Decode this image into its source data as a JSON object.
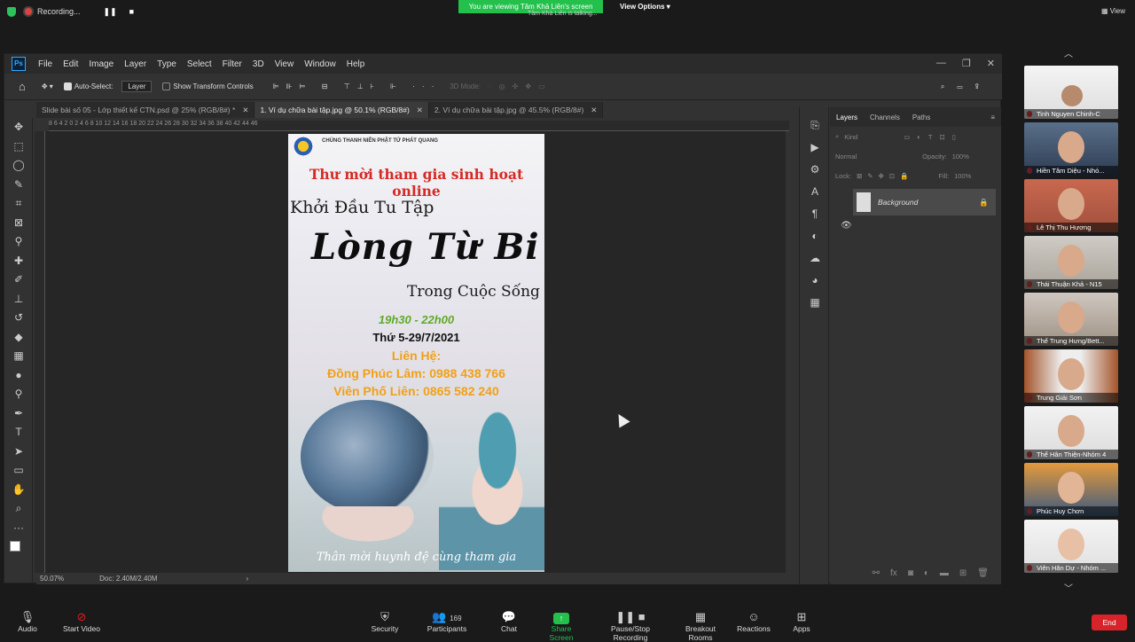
{
  "zoom": {
    "recording_label": "Recording...",
    "viewing_banner": "You are viewing Tâm Khả Liên's screen",
    "view_options": "View Options",
    "talking": "Tâm Khả Liên is talking...",
    "view_label": "View",
    "participants_count": "169",
    "bottom": {
      "audio": "Audio",
      "start_video": "Start Video",
      "security": "Security",
      "participants": "Participants",
      "chat": "Chat",
      "share_screen": "Share Screen",
      "pause_recording": "Pause/Stop Recording",
      "breakout": "Breakout Rooms",
      "reactions": "Reactions",
      "apps": "Apps",
      "end": "End"
    },
    "participants": [
      "Tinh Nguyen Chinh-C",
      "Hiền Tâm Diệu - Nhó...",
      "Lê Thị Thu Hương",
      "Thái Thuận Khả - N15",
      "Thế Trung Hưng/Bett...",
      "Trung Giải Sơn",
      "Thể Hân Thiện-Nhóm 4",
      "Phúc Huy Chơn",
      "Viên Hân Dự - Nhóm ..."
    ]
  },
  "ps": {
    "logo": "Ps",
    "menu": [
      "File",
      "Edit",
      "Image",
      "Layer",
      "Type",
      "Select",
      "Filter",
      "3D",
      "View",
      "Window",
      "Help"
    ],
    "auto_select_label": "Auto-Select:",
    "auto_select_value": "Layer",
    "transform_label": "Show Transform Controls",
    "mode_3d": "3D Mode:",
    "tabs": [
      "Slide bài số 05 - Lớp thiết kế CTN.psd @ 25% (RGB/8#) *",
      "1. Ví dụ chữa bài tập.jpg @ 50.1% (RGB/8#)",
      "2. Ví dụ chữa bài tập.jpg @ 45.5% (RGB/8#)"
    ],
    "zoom_level": "50.07%",
    "doc_size": "Doc: 2.40M/2.40M",
    "panel_tabs": [
      "Layers",
      "Channels",
      "Paths"
    ],
    "kind_label": "Kind",
    "blend_mode": "Normal",
    "opacity_label": "Opacity:",
    "opacity_value": "100%",
    "lock_label": "Lock:",
    "fill_label": "Fill:",
    "fill_value": "100%",
    "layer_name": "Background",
    "ruler_marks": "8   6   4   2   0   2   4   6   8   10   12   14   16   18   20   22   24   26   28   30   32   34   36   38   40   42   44   46"
  },
  "poster": {
    "org": "CHÚNG THANH NIÊN PHẬT TỬ PHÁT QUANG",
    "title": "Thư mời tham gia sinh hoạt online",
    "line1": "Khởi Đầu Tu Tập",
    "line2": "Lòng Từ Bi",
    "line3": "Trong  Cuộc Sống",
    "time": "19h30 - 22h00",
    "date": "Thứ 5-29/7/2021",
    "contact": "Liên Hệ:",
    "phone1": "Đồng Phúc Lâm: 0988 438 766",
    "phone2": "Viên Phố Liên: 0865 582 240",
    "footer": "Thân mời huynh đệ cùng tham gia"
  }
}
